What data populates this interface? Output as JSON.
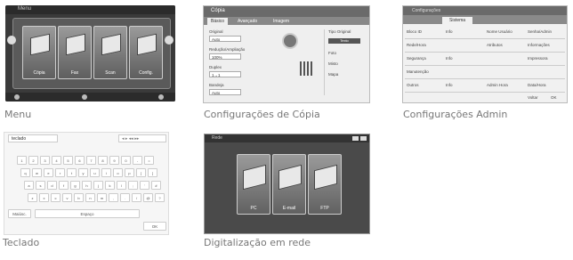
{
  "captions": {
    "menu": "Menu",
    "copia": "Configurações de Cópia",
    "admin": "Configurações Admin",
    "teclado": "Teclado",
    "digitalizacao": "Digitalização em rede"
  },
  "menu": {
    "title": "Menu",
    "tiles": [
      "Cópia",
      "Fax",
      "Scan",
      "Config."
    ]
  },
  "copia": {
    "title": "Cópia",
    "tabs": [
      "Básico",
      "Avançado",
      "Imagem"
    ],
    "fields": [
      {
        "label": "Original",
        "value": "Auto"
      },
      {
        "label": "Redução/Ampliação",
        "value": "100%"
      },
      {
        "label": "Duplex",
        "value": "1→1"
      },
      {
        "label": "Bandeja",
        "value": "Auto"
      }
    ],
    "side_title": "Tipo Original",
    "side_options": [
      "Texto",
      "Foto",
      "Misto",
      "Mapa"
    ]
  },
  "admin": {
    "title": "Configurações",
    "tab": "Sistema",
    "rows": [
      [
        "Bloco ID",
        "Info",
        "Nome Usuário",
        "Senha/Admin"
      ],
      [
        "Rede/Hora",
        "",
        "Atributos",
        "Informações"
      ],
      [
        "Segurança",
        "Info",
        "",
        "Impressora"
      ],
      [
        "Manutenção",
        "",
        "",
        ""
      ],
      [
        "Outros",
        "Info",
        "Admin Hora",
        "Data/Hora"
      ]
    ],
    "footer": [
      "Voltar",
      "OK"
    ]
  },
  "teclado": {
    "input_value": "teclado",
    "rows": [
      [
        "1",
        "2",
        "3",
        "4",
        "5",
        "6",
        "7",
        "8",
        "9",
        "0",
        "-",
        "="
      ],
      [
        "q",
        "w",
        "e",
        "r",
        "t",
        "y",
        "u",
        "i",
        "o",
        "p",
        "[",
        "]"
      ],
      [
        "a",
        "s",
        "d",
        "f",
        "g",
        "h",
        "j",
        "k",
        "l",
        ";",
        "'",
        "#"
      ],
      [
        "z",
        "x",
        "c",
        "v",
        "b",
        "n",
        "m",
        ",",
        ".",
        "/",
        "@",
        "?"
      ]
    ],
    "space_label": "Espaço",
    "shift_label": "Maiúsc.",
    "ok_label": "OK"
  },
  "digitalizacao": {
    "title": "Rede",
    "tiles": [
      "PC",
      "E-mail",
      "FTP"
    ]
  }
}
